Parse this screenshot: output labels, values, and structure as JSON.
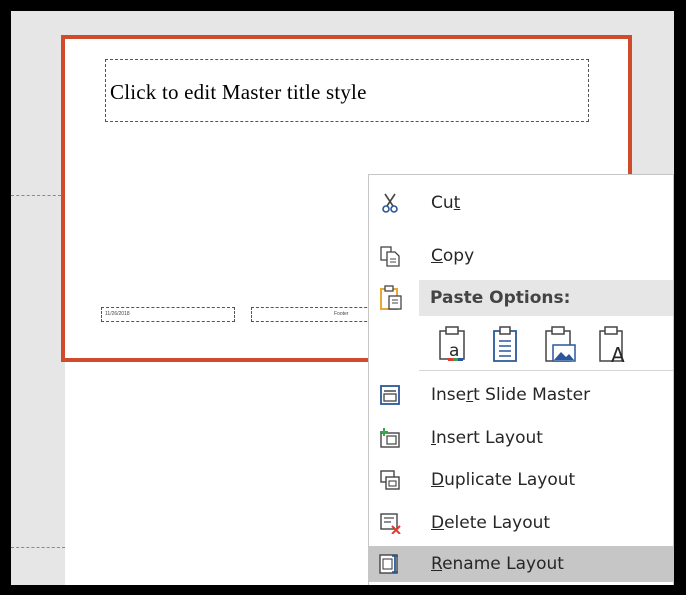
{
  "slide": {
    "title_placeholder": "Click to edit Master title style",
    "footer_date": "11/26/2018",
    "footer_text": "Footer"
  },
  "context_menu": {
    "cut": {
      "before": "Cu",
      "key": "t",
      "after": ""
    },
    "copy": {
      "before": "",
      "key": "C",
      "after": "opy"
    },
    "paste_options_header": "Paste Options:",
    "paste_icons": [
      "paste-use-destination-theme-icon",
      "paste-keep-source-formatting-icon",
      "paste-picture-icon",
      "paste-keep-text-only-icon"
    ],
    "insert_slide_master": {
      "before": "Inse",
      "key": "r",
      "after": "t Slide Master"
    },
    "insert_layout": {
      "before": "",
      "key": "I",
      "after": "nsert Layout"
    },
    "duplicate_layout": {
      "before": "",
      "key": "D",
      "after": "uplicate Layout"
    },
    "delete_layout": {
      "before": "",
      "key": "D",
      "after": "elete Layout"
    },
    "rename_layout": {
      "before": "",
      "key": "R",
      "after": "ename Layout"
    }
  },
  "colors": {
    "selection_border": "#d04a2c",
    "menu_hover": "#c6c6c6",
    "icon_orange": "#e8a838",
    "icon_blue": "#2b579a",
    "delete_red": "#e03c31",
    "insert_green": "#3aa54a"
  }
}
